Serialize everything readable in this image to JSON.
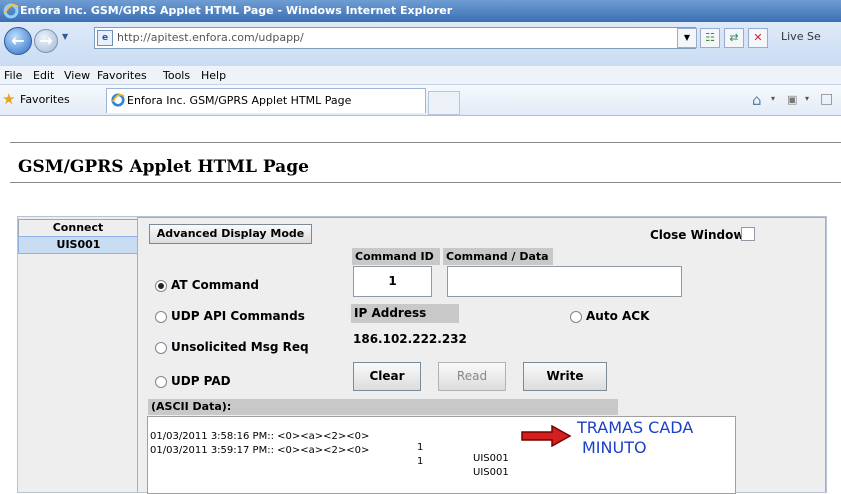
{
  "window": {
    "title": "Enfora Inc. GSM/GPRS Applet HTML Page - Windows Internet Explorer"
  },
  "address_bar": {
    "url": "http://apitest.enfora.com/udpapp/",
    "live_search": "Live Se"
  },
  "menu": {
    "items": [
      "File",
      "Edit",
      "View",
      "Favorites",
      "Tools",
      "Help"
    ]
  },
  "favorites_bar": {
    "favorites_label": "Favorites",
    "tab_title": "Enfora Inc. GSM/GPRS Applet HTML Page"
  },
  "page": {
    "heading": "GSM/GPRS Applet HTML Page"
  },
  "applet": {
    "side_tabs": [
      "Connect",
      "UIS001"
    ],
    "advanced_button": "Advanced Display Mode",
    "close_window_label": "Close Window",
    "command_id_header": "Command ID",
    "command_data_header": "Command / Data",
    "command_id_value": "1",
    "command_data_value": "",
    "radios": [
      {
        "label": "AT Command",
        "selected": true
      },
      {
        "label": "UDP API Commands",
        "selected": false
      },
      {
        "label": "Unsolicited Msg Req",
        "selected": false
      },
      {
        "label": "UDP PAD",
        "selected": false
      }
    ],
    "ip_address_header": "IP Address",
    "ip_address_value": "186.102.222.232",
    "auto_ack_label": "Auto ACK",
    "buttons": {
      "clear": "Clear",
      "read": "Read",
      "write": "Write"
    },
    "log_header": "(ASCII Data):",
    "log_lines": [
      {
        "time": "01/03/2011 3:58:16 PM:: <0><a><2><0>",
        "id": "1",
        "unit": "UIS001"
      },
      {
        "time": "01/03/2011 3:59:17 PM:: <0><a><2><0>",
        "id": "1",
        "unit": "UIS001"
      }
    ],
    "annotation": {
      "line1": "TRAMAS CADA",
      "line2": "MINUTO",
      "arrow_color": "#d41f1f"
    }
  }
}
